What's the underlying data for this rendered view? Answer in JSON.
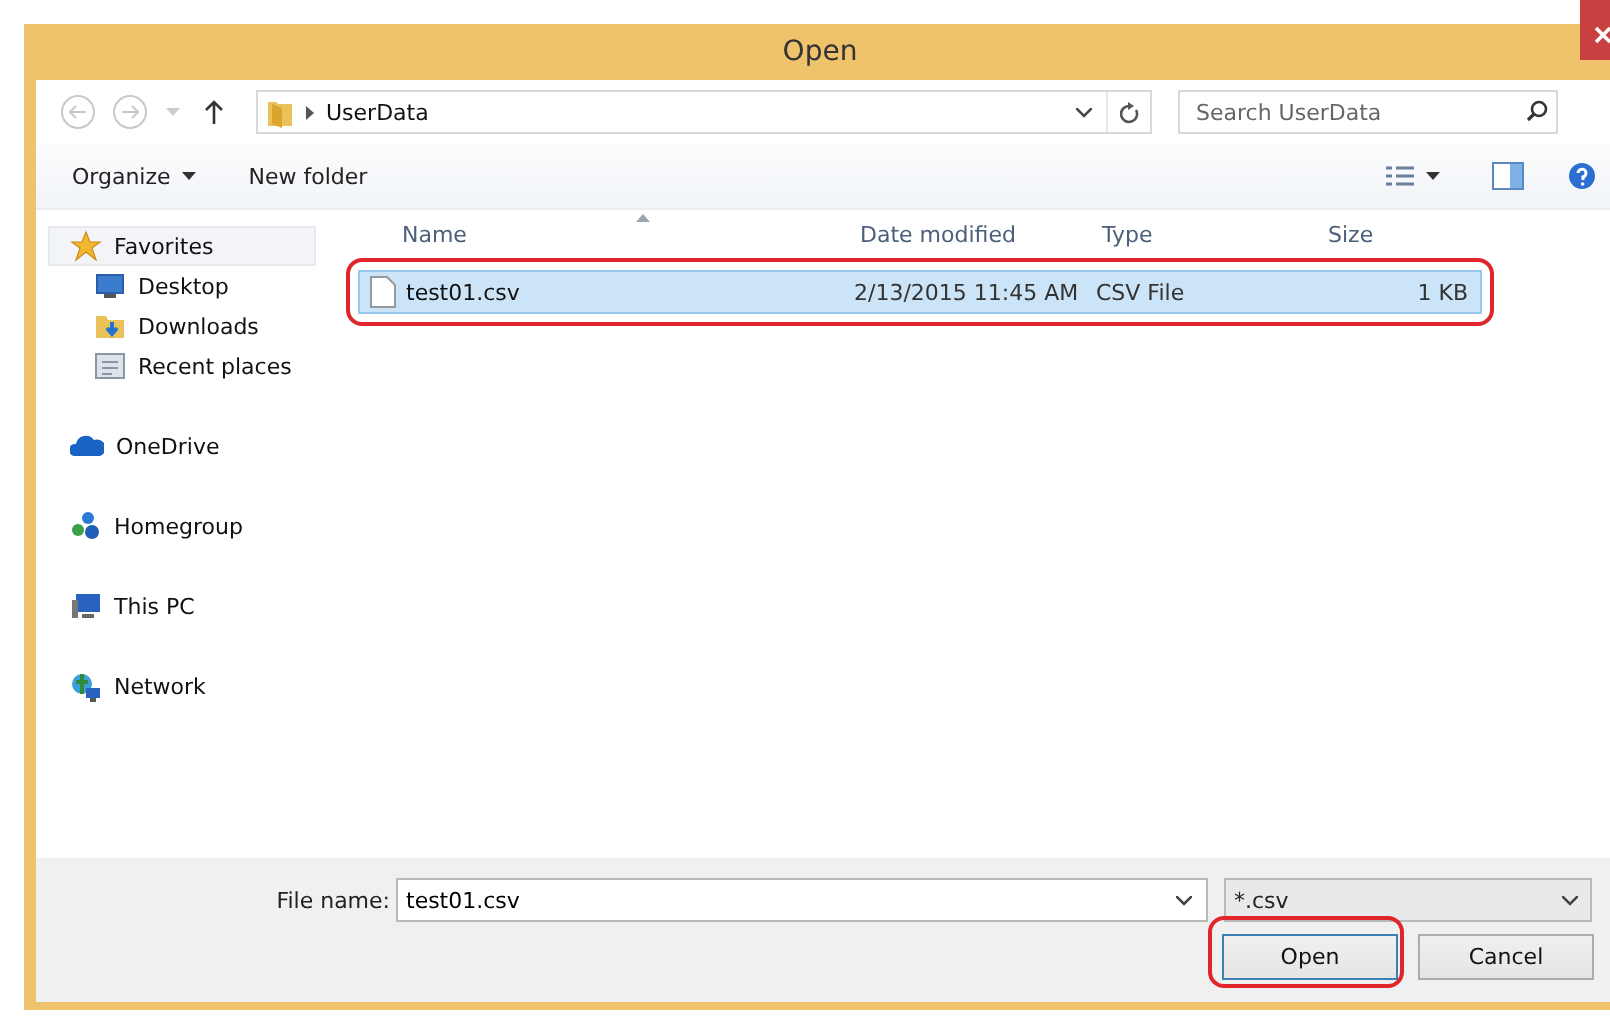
{
  "window": {
    "title": "Open"
  },
  "address": {
    "path": "UserData",
    "search_placeholder": "Search UserData"
  },
  "toolbar": {
    "organize": "Organize",
    "new_folder": "New folder"
  },
  "sidebar": {
    "groups": [
      {
        "label": "Favorites",
        "kind": "star",
        "selected": true,
        "children": [
          {
            "label": "Desktop",
            "kind": "desktop",
            "selected": false
          },
          {
            "label": "Downloads",
            "kind": "downloads",
            "selected": false
          },
          {
            "label": "Recent places",
            "kind": "recent",
            "selected": false
          }
        ]
      },
      {
        "label": "OneDrive",
        "kind": "cloud",
        "selected": false
      },
      {
        "label": "Homegroup",
        "kind": "homegroup",
        "selected": false
      },
      {
        "label": "This PC",
        "kind": "pc",
        "selected": false
      },
      {
        "label": "Network",
        "kind": "network",
        "selected": false
      }
    ]
  },
  "columns": [
    "Name",
    "Date modified",
    "Type",
    "Size"
  ],
  "rows": [
    {
      "name": "test01.csv",
      "date": "2/13/2015 11:45 AM",
      "type": "CSV File",
      "size": "1 KB",
      "selected": true,
      "highlighted": true
    }
  ],
  "file_name": {
    "label": "File name:",
    "value": "test01.csv"
  },
  "filter": {
    "value": "*.csv"
  },
  "buttons": [
    {
      "label": "Open",
      "highlighted": true
    },
    {
      "label": "Cancel",
      "highlighted": false
    }
  ]
}
